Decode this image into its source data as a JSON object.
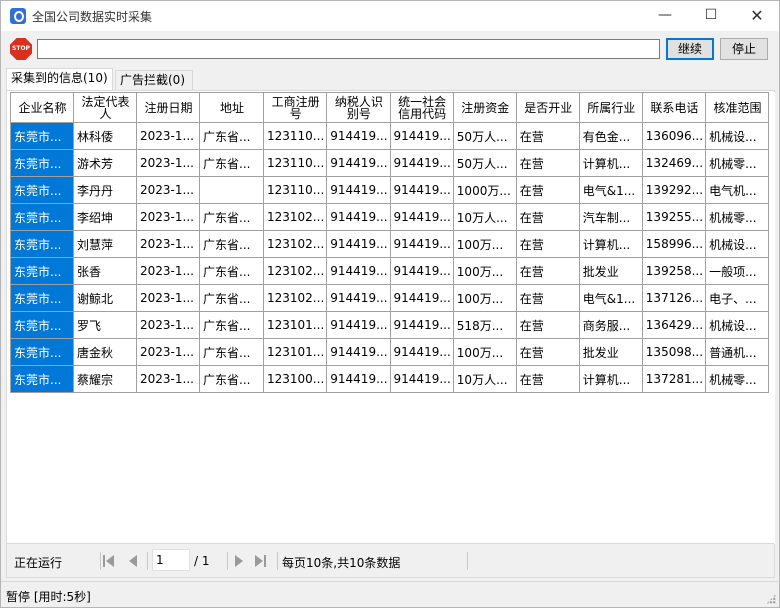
{
  "window": {
    "title": "全国公司数据实时采集",
    "minimize": "—",
    "maximize": "☐",
    "close": "✕"
  },
  "toolbar": {
    "stop_icon": "STOP",
    "url_value": "",
    "continue_label": "继续",
    "stop_label": "停止"
  },
  "tabs": [
    {
      "label": "采集到的信息(10)",
      "active": true
    },
    {
      "label": "广告拦截(0)",
      "active": false
    }
  ],
  "table": {
    "headers": [
      "企业名称",
      "法定代表人",
      "注册日期",
      "地址",
      "工商注册号",
      "纳税人识别号",
      "统一社会信用代码",
      "注册资金",
      "是否开业",
      "所属行业",
      "联系电话",
      "核准范围"
    ],
    "rows": [
      [
        "东莞市...",
        "林科倭",
        "2023-1...",
        "广东省...",
        "123110...",
        "914419...",
        "914419...",
        "50万人...",
        "在营",
        "有色金...",
        "136096...",
        "机械设..."
      ],
      [
        "东莞市...",
        "游术芳",
        "2023-1...",
        "广东省...",
        "123110...",
        "914419...",
        "914419...",
        "50万人...",
        "在营",
        "计算机...",
        "132469...",
        "机械零..."
      ],
      [
        "东莞市...",
        "李丹丹",
        "2023-1...",
        "",
        "123110...",
        "914419...",
        "914419...",
        "1000万...",
        "在营",
        "电气&1...",
        "139292...",
        "电气机..."
      ],
      [
        "东莞市...",
        "李绍坤",
        "2023-1...",
        "广东省...",
        "123102...",
        "914419...",
        "914419...",
        "10万人...",
        "在营",
        "汽车制...",
        "139255...",
        "机械零..."
      ],
      [
        "东莞市...",
        "刘慧萍",
        "2023-1...",
        "广东省...",
        "123102...",
        "914419...",
        "914419...",
        "100万...",
        "在营",
        "计算机...",
        "158996...",
        "机械设..."
      ],
      [
        "东莞市...",
        "张香",
        "2023-1...",
        "广东省...",
        "123102...",
        "914419...",
        "914419...",
        "100万...",
        "在营",
        "批发业",
        "139258...",
        "一般项..."
      ],
      [
        "东莞市...",
        "谢鲸北",
        "2023-1...",
        "广东省...",
        "123102...",
        "914419...",
        "914419...",
        "100万...",
        "在营",
        "电气&1...",
        "137126...",
        "电子、..."
      ],
      [
        "东莞市...",
        "罗飞",
        "2023-1...",
        "广东省...",
        "123101...",
        "914419...",
        "914419...",
        "518万...",
        "在营",
        "商务服...",
        "136429...",
        "机械设..."
      ],
      [
        "东莞市...",
        "唐金秋",
        "2023-1...",
        "广东省...",
        "123101...",
        "914419...",
        "914419...",
        "100万...",
        "在营",
        "批发业",
        "135098...",
        "普通机..."
      ],
      [
        "东莞市...",
        "蔡耀宗",
        "2023-1...",
        "广东省...",
        "123100...",
        "914419...",
        "914419...",
        "10万人...",
        "在营",
        "计算机...",
        "137281...",
        "机械零..."
      ]
    ]
  },
  "pager": {
    "status": "正在运行",
    "page": "1",
    "total": "/ 1",
    "info": "每页10条,共10条数据"
  },
  "statusbar": {
    "text": "暂停  [用时:5秒]"
  },
  "colors": {
    "selection": "#0078d7",
    "stop_icon": "#d92f1f"
  }
}
